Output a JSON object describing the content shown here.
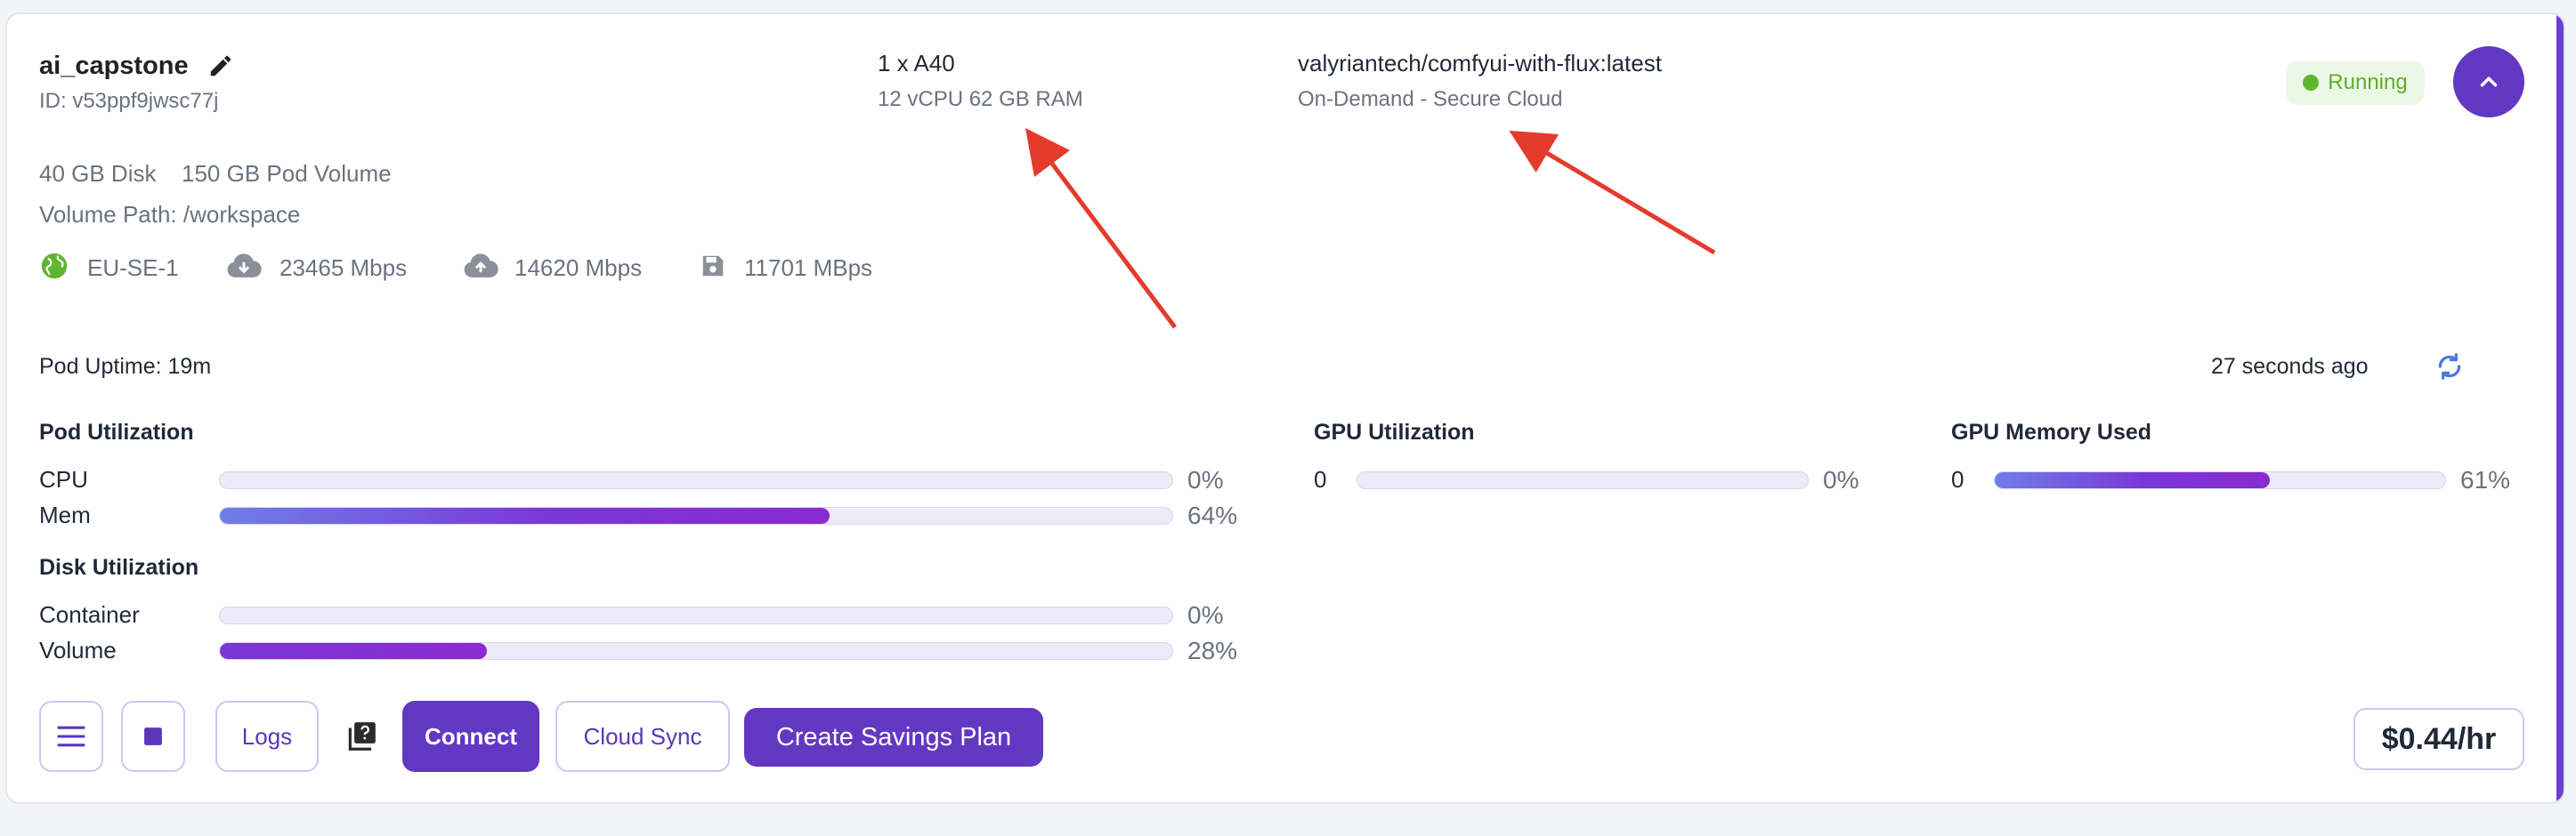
{
  "pod": {
    "name": "ai_capstone",
    "id_text": "ID: v53ppf9jwsc77j",
    "gpu": "1 x A40",
    "specs": "12 vCPU 62 GB RAM",
    "image": "valyriantech/comfyui-with-flux:latest",
    "plan": "On-Demand - Secure Cloud",
    "status": "Running",
    "disk": "40 GB Disk",
    "pod_volume": "150 GB Pod Volume",
    "volume_path": "Volume Path: /workspace",
    "region": "EU-SE-1",
    "download_speed": "23465 Mbps",
    "upload_speed": "14620 Mbps",
    "disk_speed": "11701 MBps",
    "uptime": "Pod Uptime: 19m",
    "last_updated": "27 seconds ago"
  },
  "utilization": {
    "pod_heading": "Pod Utilization",
    "cpu_label": "CPU",
    "cpu_pct": "0%",
    "cpu_value": 0,
    "mem_label": "Mem",
    "mem_pct": "64%",
    "mem_value": 64,
    "disk_heading": "Disk Utilization",
    "container_label": "Container",
    "container_pct": "0%",
    "container_value": 0,
    "volume_label": "Volume",
    "volume_pct": "28%",
    "volume_value": 28,
    "gpu_heading": "GPU Utilization",
    "gpu_index": "0",
    "gpu_pct": "0%",
    "gpu_value": 0,
    "gpu_mem_heading": "GPU Memory Used",
    "gpu_mem_index": "0",
    "gpu_mem_pct": "61%",
    "gpu_mem_value": 61
  },
  "actions": {
    "logs": "Logs",
    "connect": "Connect",
    "cloud_sync": "Cloud Sync",
    "savings_plan": "Create Savings Plan",
    "price": "$0.44/hr"
  },
  "icons": {
    "edit": "pencil-icon",
    "region": "globe-icon",
    "download": "cloud-download-icon",
    "upload": "cloud-upload-icon",
    "disk": "floppy-disk-icon",
    "refresh": "refresh-icon",
    "collapse": "chevron-up-icon",
    "menu": "hamburger-menu-icon",
    "stop": "stop-icon",
    "help": "help-docs-icon"
  },
  "colors": {
    "accent": "#6238c2",
    "running": "#5fb52f",
    "annotation_arrow": "#e53a2e"
  }
}
